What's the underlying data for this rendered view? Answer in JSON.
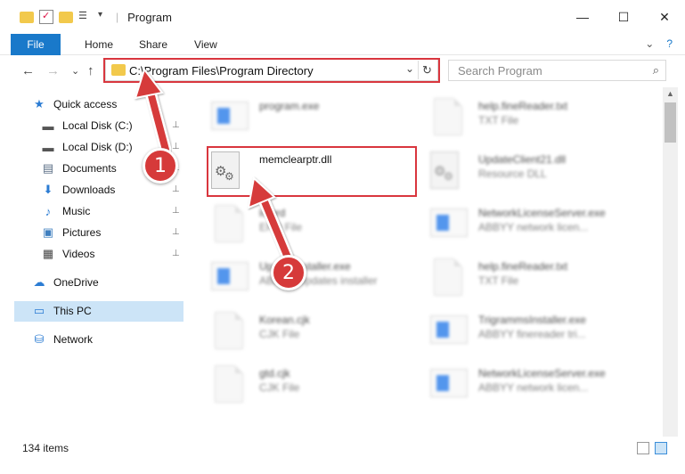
{
  "window": {
    "title": "Program",
    "minimize": "—",
    "maximize": "☐",
    "close": "✕"
  },
  "ribbon": {
    "file": "File",
    "tabs": [
      "Home",
      "Share",
      "View"
    ],
    "expand": "⌄",
    "help": "?"
  },
  "nav": {
    "back": "←",
    "forward": "→",
    "recent": "⌄",
    "up": "↑",
    "address": "C:\\Program Files\\Program Directory",
    "address_dropdown": "⌄",
    "refresh": "↻",
    "search_placeholder": "Search Program",
    "search_icon": "⌕"
  },
  "sidebar": {
    "items": [
      {
        "label": "Quick access",
        "icon": "star-icon",
        "glyph": "★",
        "color": "#2b7cd3",
        "pinned": false
      },
      {
        "label": "Local Disk (C:)",
        "icon": "drive-icon",
        "glyph": "▬",
        "color": "#555555",
        "pinned": true
      },
      {
        "label": "Local Disk (D:)",
        "icon": "drive-icon",
        "glyph": "▬",
        "color": "#555555",
        "pinned": true
      },
      {
        "label": "Documents",
        "icon": "documents-icon",
        "glyph": "▤",
        "color": "#5a6e85",
        "pinned": true
      },
      {
        "label": "Downloads",
        "icon": "download-icon",
        "glyph": "⬇",
        "color": "#2b7cd3",
        "pinned": true
      },
      {
        "label": "Music",
        "icon": "music-icon",
        "glyph": "♪",
        "color": "#2b7cd3",
        "pinned": true
      },
      {
        "label": "Pictures",
        "icon": "pictures-icon",
        "glyph": "▣",
        "color": "#3f7fbf",
        "pinned": true
      },
      {
        "label": "Videos",
        "icon": "videos-icon",
        "glyph": "▦",
        "color": "#444444",
        "pinned": true
      },
      {
        "label": "OneDrive",
        "icon": "cloud-icon",
        "glyph": "☁",
        "color": "#2b7cd3",
        "pinned": false
      },
      {
        "label": "This PC",
        "icon": "computer-icon",
        "glyph": "▭",
        "color": "#2b7cd3",
        "pinned": false
      },
      {
        "label": "Network",
        "icon": "network-icon",
        "glyph": "⛁",
        "color": "#2b7cd3",
        "pinned": false
      }
    ],
    "pin_glyph": "📌"
  },
  "files": [
    {
      "name": "program.exe",
      "desc": "",
      "kind": "exe-blur"
    },
    {
      "name": "help.fineReader.txt",
      "desc": "TXT File",
      "kind": "doc-blur"
    },
    {
      "name": "memclearptr.dll",
      "desc": "",
      "kind": "dll"
    },
    {
      "name": "UpdateClient21.dll",
      "desc": "Resource DLL",
      "kind": "gear-blur"
    },
    {
      "name": "lc.erd",
      "desc": "ERD File",
      "kind": "doc-blur"
    },
    {
      "name": "NetworkLicenseServer.exe",
      "desc": "ABBYY network licen...",
      "kind": "exe-blur"
    },
    {
      "name": "UpdateInstaller.exe",
      "desc": "ABBYY Updates installer",
      "kind": "exe-blur"
    },
    {
      "name": "help.fineReader.txt",
      "desc": "TXT File",
      "kind": "doc-blur"
    },
    {
      "name": "Korean.cjk",
      "desc": "CJK File",
      "kind": "doc-blur"
    },
    {
      "name": "TrigrammsInstaller.exe",
      "desc": "ABBYY finereader tri...",
      "kind": "exe-blur"
    },
    {
      "name": "gtd.cjk",
      "desc": "CJK File",
      "kind": "doc-blur"
    },
    {
      "name": "NetworkLicenseServer.exe",
      "desc": "ABBYY network licen...",
      "kind": "exe-blur"
    }
  ],
  "status": {
    "item_count": "134 items"
  },
  "annotations": {
    "step1": "1",
    "step2": "2",
    "highlight_color": "#d9363e"
  }
}
